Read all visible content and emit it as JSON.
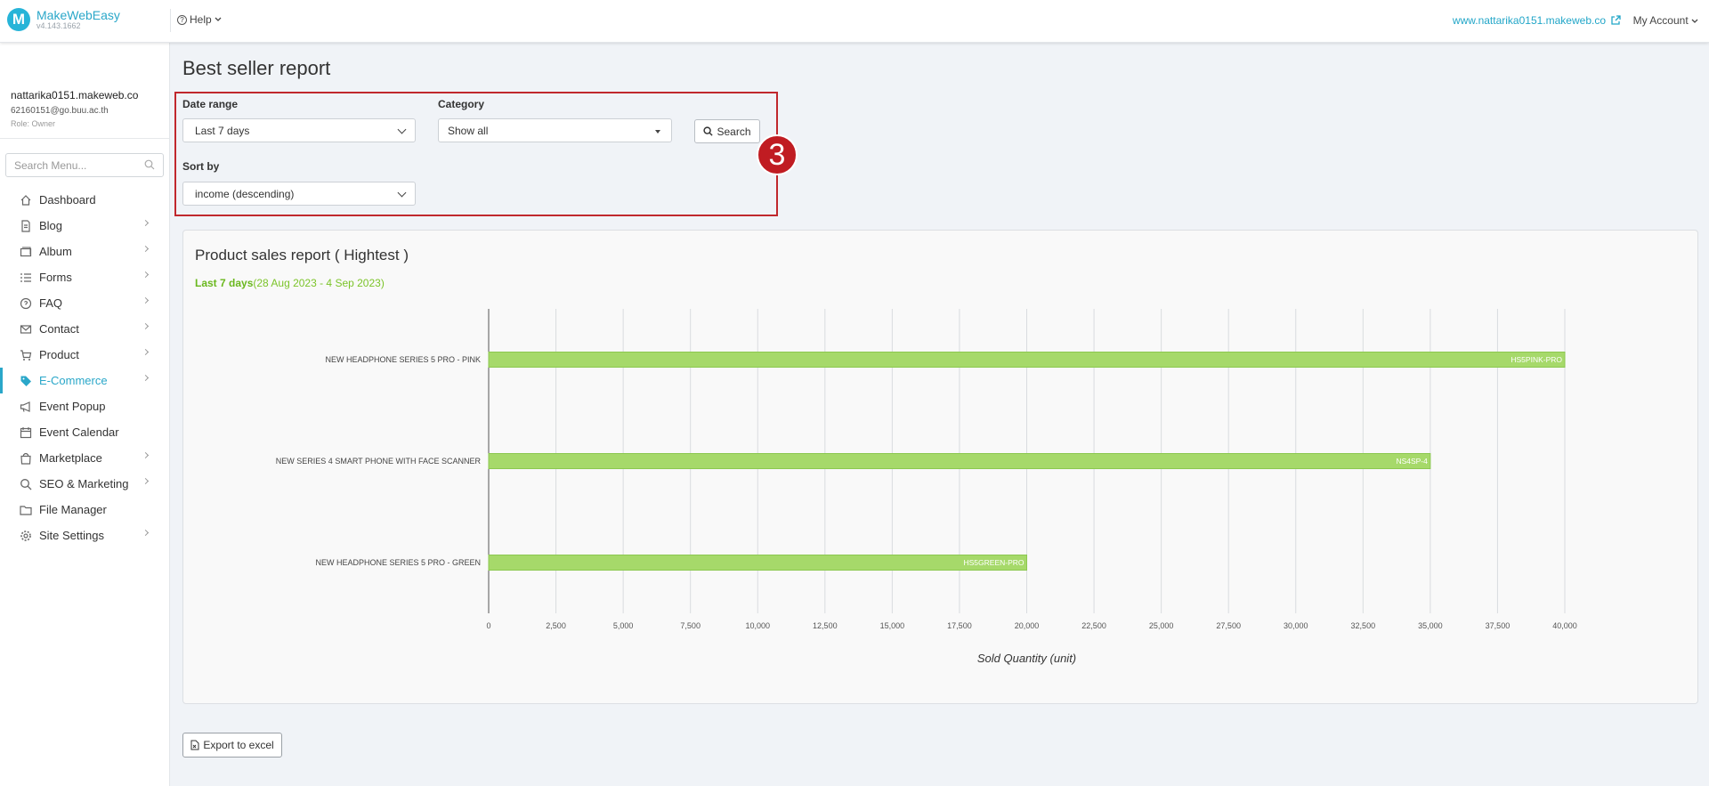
{
  "app": {
    "name": "MakeWebEasy",
    "version": "v4.143.1662",
    "logo_letter": "M",
    "help_label": "Help",
    "site_url": "www.nattarika0151.makeweb.co",
    "my_account_label": "My Account"
  },
  "user": {
    "site": "nattarika0151.makeweb.co",
    "email": "62160151@go.buu.ac.th",
    "role": "Role: Owner"
  },
  "sidebar": {
    "search_placeholder": "Search Menu...",
    "items": [
      {
        "label": "Dashboard",
        "icon": "home-icon",
        "has_submenu": false,
        "active": false
      },
      {
        "label": "Blog",
        "icon": "document-icon",
        "has_submenu": true,
        "active": false
      },
      {
        "label": "Album",
        "icon": "album-icon",
        "has_submenu": true,
        "active": false
      },
      {
        "label": "Forms",
        "icon": "list-icon",
        "has_submenu": true,
        "active": false
      },
      {
        "label": "FAQ",
        "icon": "faq-icon",
        "has_submenu": true,
        "active": false
      },
      {
        "label": "Contact",
        "icon": "envelope-icon",
        "has_submenu": true,
        "active": false
      },
      {
        "label": "Product",
        "icon": "cart-icon",
        "has_submenu": true,
        "active": false
      },
      {
        "label": "E-Commerce",
        "icon": "tag-icon",
        "has_submenu": true,
        "active": true
      },
      {
        "label": "Event Popup",
        "icon": "megaphone-icon",
        "has_submenu": false,
        "active": false
      },
      {
        "label": "Event Calendar",
        "icon": "calendar-icon",
        "has_submenu": false,
        "active": false
      },
      {
        "label": "Marketplace",
        "icon": "bag-icon",
        "has_submenu": true,
        "active": false
      },
      {
        "label": "SEO & Marketing",
        "icon": "search-icon",
        "has_submenu": true,
        "active": false
      },
      {
        "label": "File Manager",
        "icon": "folder-icon",
        "has_submenu": false,
        "active": false
      },
      {
        "label": "Site Settings",
        "icon": "gear-icon",
        "has_submenu": true,
        "active": false
      }
    ]
  },
  "page": {
    "title": "Best seller report",
    "step_number": "3"
  },
  "filters": {
    "date_range_label": "Date range",
    "date_range_value": "Last 7 days",
    "category_label": "Category",
    "category_value": "Show all",
    "sort_label": "Sort by",
    "sort_value": "income (descending)",
    "search_label": "Search"
  },
  "report": {
    "title": "Product sales report ( Hightest )",
    "period_label": "Last 7 days",
    "period_range": "(28 Aug 2023 - 4 Sep 2023)"
  },
  "chart_data": {
    "type": "bar",
    "orientation": "horizontal",
    "categories": [
      "NEW HEADPHONE SERIES 5 PRO - PINK",
      "NEW SERIES 4 SMART PHONE WITH FACE SCANNER",
      "NEW HEADPHONE SERIES 5 PRO - GREEN"
    ],
    "series": [
      {
        "values": [
          40000,
          35000,
          20000
        ]
      }
    ],
    "data_labels": [
      "HS5PINK-PRO",
      "NS4SP-4",
      "HS5GREEN-PRO"
    ],
    "xlabel": "Sold Quantity (unit)",
    "ylabel": "",
    "xlim": [
      0,
      40000
    ],
    "tick_step": 2500,
    "tick_labels": [
      "0",
      "2,500",
      "5,000",
      "7,500",
      "10,000",
      "12,500",
      "15,000",
      "17,500",
      "20,000",
      "22,500",
      "25,000",
      "27,500",
      "30,000",
      "32,500",
      "35,000",
      "37,500",
      "40,000"
    ],
    "grid": true,
    "bar_color": "#a6d96a",
    "bar_border_color": "#8cc850"
  },
  "export": {
    "label": "Export to excel"
  }
}
